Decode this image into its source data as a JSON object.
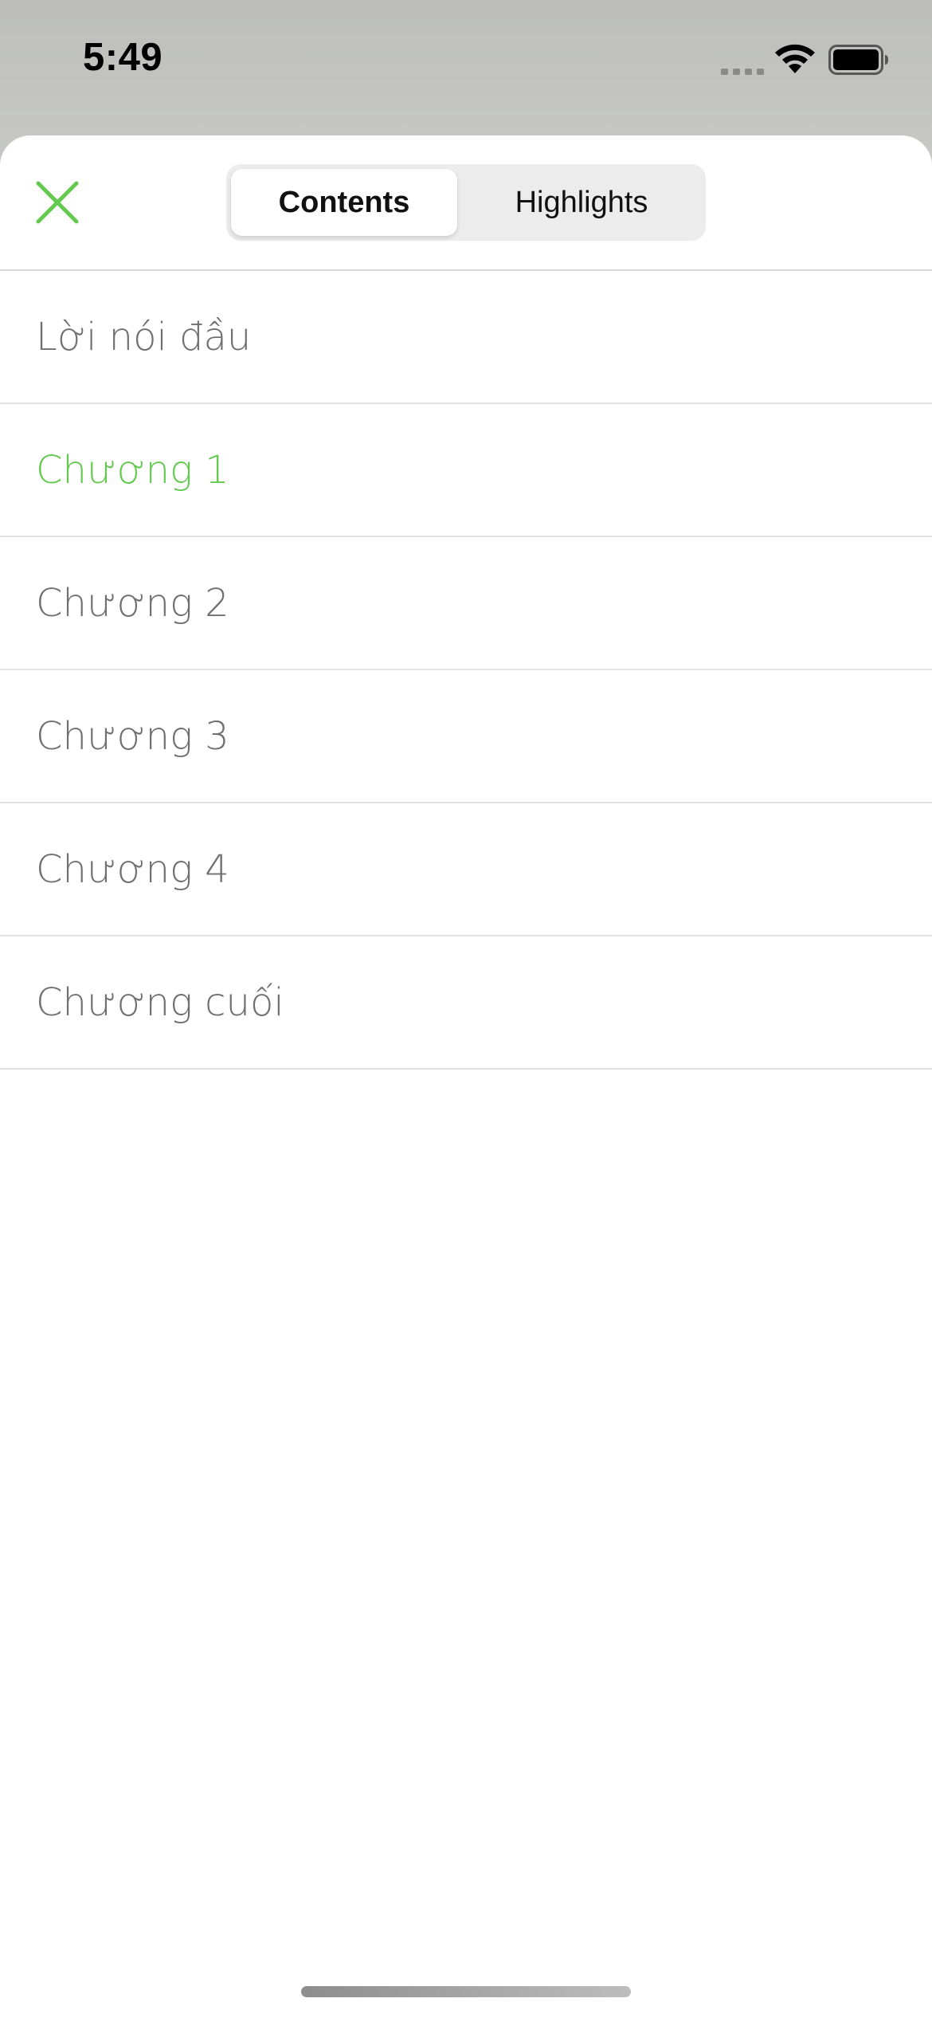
{
  "status_bar": {
    "time": "5:49",
    "icons": [
      "cellular-signal-icon",
      "wifi-icon",
      "battery-icon"
    ]
  },
  "header": {
    "close_icon": "close-icon",
    "accent_color": "#64c94f",
    "segments": [
      {
        "label": "Contents",
        "selected": true
      },
      {
        "label": "Highlights",
        "selected": false
      }
    ]
  },
  "toc": {
    "items": [
      {
        "label": "Lời nói đầu",
        "active": false
      },
      {
        "label": "Chương 1",
        "active": true
      },
      {
        "label": "Chương 2",
        "active": false
      },
      {
        "label": "Chương 3",
        "active": false
      },
      {
        "label": "Chương 4",
        "active": false
      },
      {
        "label": "Chương cuối",
        "active": false
      }
    ]
  }
}
